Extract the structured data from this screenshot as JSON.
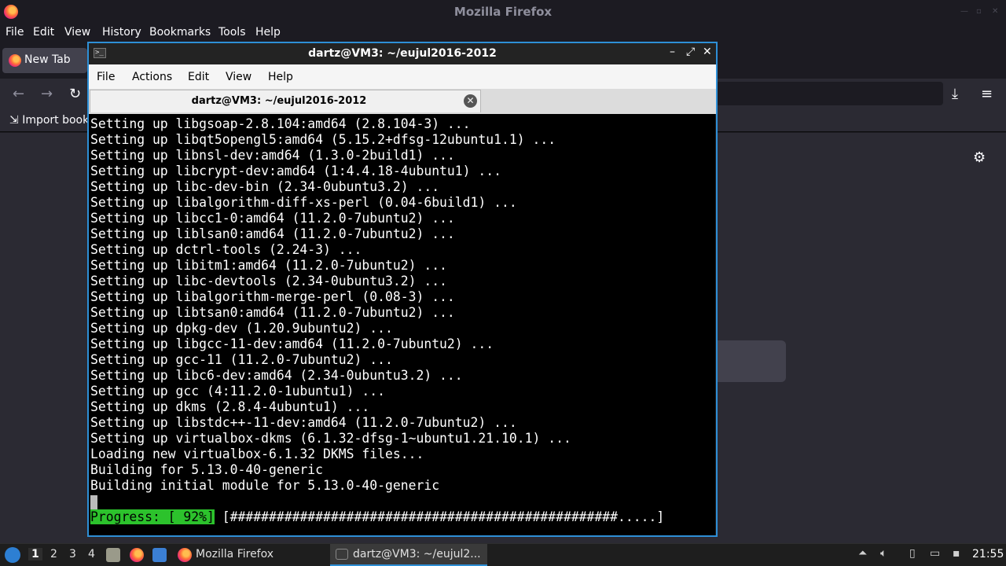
{
  "firefox": {
    "window_title": "Mozilla Firefox",
    "menu": [
      "File",
      "Edit",
      "View",
      "History",
      "Bookmarks",
      "Tools",
      "Help"
    ],
    "tab_label": "New Tab",
    "bookmark_label": "Import book"
  },
  "terminal": {
    "window_title": "dartz@VM3: ~/eujul2016-2012",
    "menu": [
      "File",
      "Actions",
      "Edit",
      "View",
      "Help"
    ],
    "tab_label": "dartz@VM3: ~/eujul2016-2012",
    "lines": [
      "Setting up libgsoap-2.8.104:amd64 (2.8.104-3) ...",
      "Setting up libqt5opengl5:amd64 (5.15.2+dfsg-12ubuntu1.1) ...",
      "Setting up libnsl-dev:amd64 (1.3.0-2build1) ...",
      "Setting up libcrypt-dev:amd64 (1:4.4.18-4ubuntu1) ...",
      "Setting up libc-dev-bin (2.34-0ubuntu3.2) ...",
      "Setting up libalgorithm-diff-xs-perl (0.04-6build1) ...",
      "Setting up libcc1-0:amd64 (11.2.0-7ubuntu2) ...",
      "Setting up liblsan0:amd64 (11.2.0-7ubuntu2) ...",
      "Setting up dctrl-tools (2.24-3) ...",
      "Setting up libitm1:amd64 (11.2.0-7ubuntu2) ...",
      "Setting up libc-devtools (2.34-0ubuntu3.2) ...",
      "Setting up libalgorithm-merge-perl (0.08-3) ...",
      "Setting up libtsan0:amd64 (11.2.0-7ubuntu2) ...",
      "Setting up dpkg-dev (1.20.9ubuntu2) ...",
      "Setting up libgcc-11-dev:amd64 (11.2.0-7ubuntu2) ...",
      "Setting up gcc-11 (11.2.0-7ubuntu2) ...",
      "Setting up libc6-dev:amd64 (2.34-0ubuntu3.2) ...",
      "Setting up gcc (4:11.2.0-1ubuntu1) ...",
      "Setting up dkms (2.8.4-4ubuntu1) ...",
      "Setting up libstdc++-11-dev:amd64 (11.2.0-7ubuntu2) ...",
      "Setting up virtualbox-dkms (6.1.32-dfsg-1~ubuntu1.21.10.1) ...",
      "Loading new virtualbox-6.1.32 DKMS files...",
      "Building for 5.13.0-40-generic",
      "Building initial module for 5.13.0-40-generic"
    ],
    "progress_label": "Progress: [ 92%]",
    "progress_bar": " [##################################################.....]",
    "progress_percent": 92
  },
  "taskbar": {
    "workspaces": [
      "1",
      "2",
      "3",
      "4"
    ],
    "active_workspace": "1",
    "tasks": [
      {
        "label": "Mozilla Firefox"
      },
      {
        "label": "dartz@VM3: ~/eujul2..."
      }
    ],
    "clock": "21:55"
  },
  "colors": {
    "accent": "#2e8fd6",
    "progress_green": "#2cc22c",
    "terminal_bg": "#000000"
  }
}
